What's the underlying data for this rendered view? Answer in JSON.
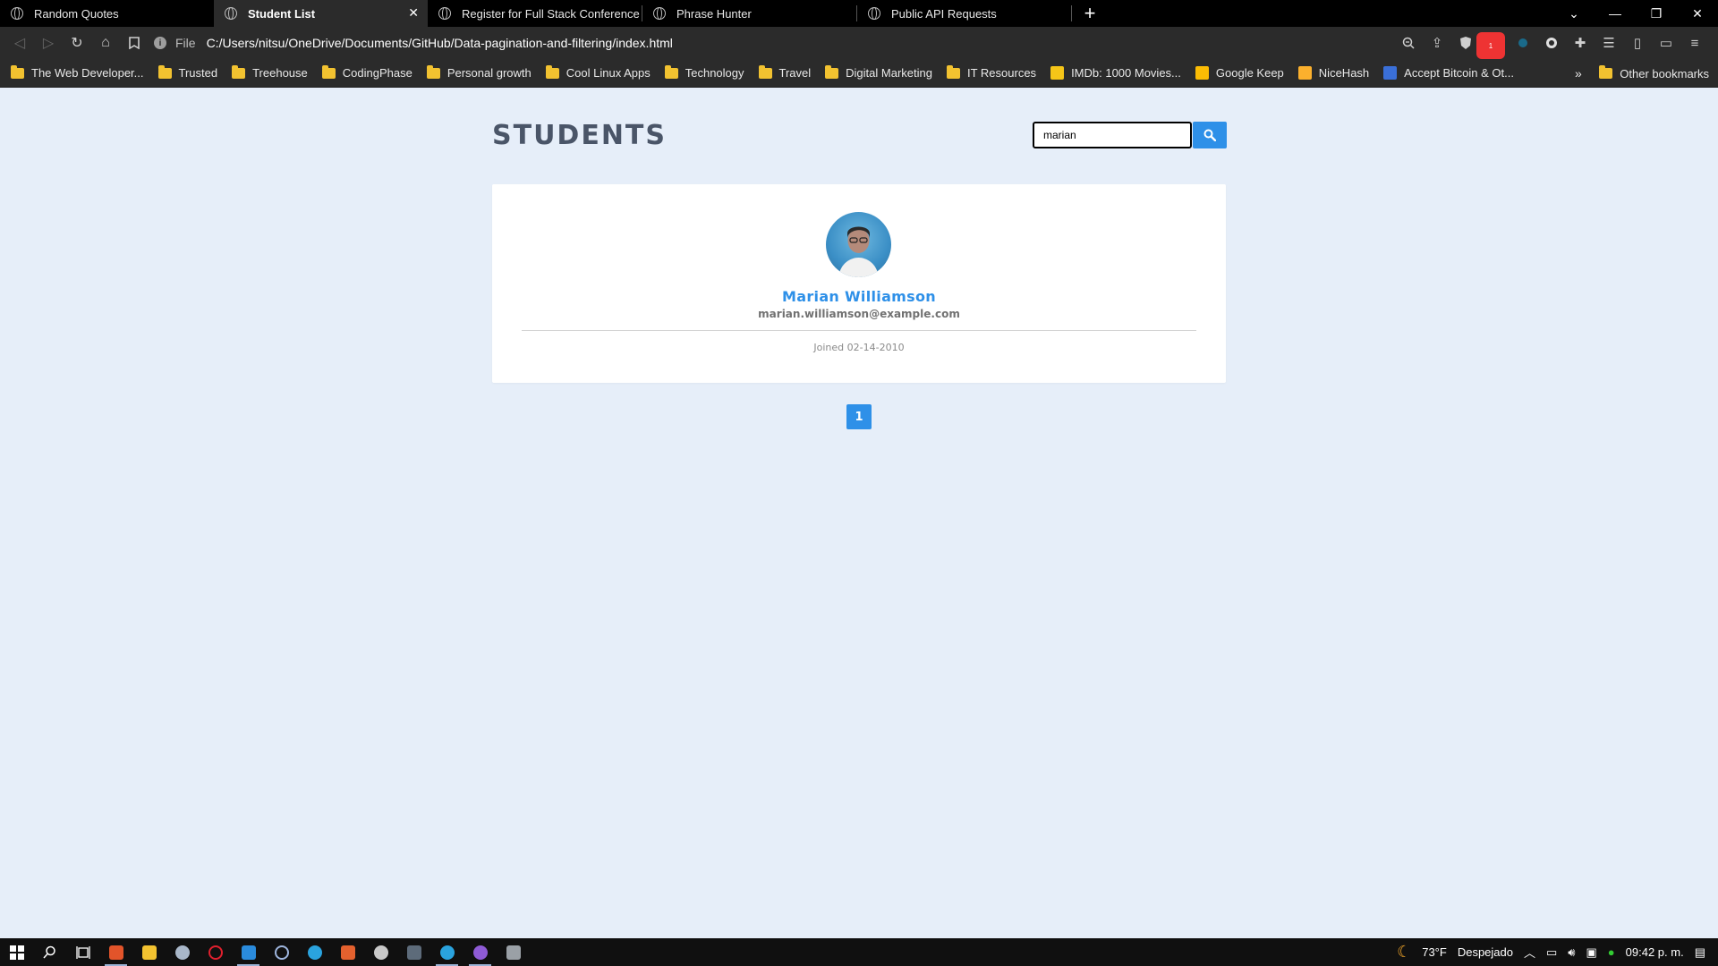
{
  "browser": {
    "tabs": [
      {
        "title": "Random Quotes",
        "active": false
      },
      {
        "title": "Student List",
        "active": true
      },
      {
        "title": "Register for Full Stack Conference",
        "active": false
      },
      {
        "title": "Phrase Hunter",
        "active": false
      },
      {
        "title": "Public API Requests",
        "active": false
      }
    ],
    "address": {
      "scheme": "File",
      "url": "C:/Users/nitsu/OneDrive/Documents/GitHub/Data-pagination-and-filtering/index.html"
    },
    "alert_badge_count": "1",
    "bookmarks": [
      {
        "label": "The Web Developer...",
        "icon": "folder-icon"
      },
      {
        "label": "Trusted",
        "icon": "folder-icon"
      },
      {
        "label": "Treehouse",
        "icon": "folder-icon"
      },
      {
        "label": "CodingPhase",
        "icon": "folder-icon"
      },
      {
        "label": "Personal growth",
        "icon": "folder-icon"
      },
      {
        "label": "Cool Linux Apps",
        "icon": "folder-icon"
      },
      {
        "label": "Technology",
        "icon": "folder-icon"
      },
      {
        "label": "Travel",
        "icon": "folder-icon"
      },
      {
        "label": "Digital Marketing",
        "icon": "folder-icon"
      },
      {
        "label": "IT Resources",
        "icon": "folder-icon"
      },
      {
        "label": "IMDb: 1000 Movies...",
        "icon": "imdb-icon"
      },
      {
        "label": "Google Keep",
        "icon": "keep-icon"
      },
      {
        "label": "NiceHash",
        "icon": "nicehash-icon"
      },
      {
        "label": "Accept Bitcoin & Ot...",
        "icon": "bitcoin-icon"
      }
    ],
    "other_bookmarks": "Other bookmarks"
  },
  "page": {
    "title": "STUDENTS",
    "search": {
      "value": "marian"
    },
    "student": {
      "name": "Marian Williamson",
      "email": "marian.williamson@example.com",
      "joined": "Joined 02-14-2010"
    },
    "pagination": [
      "1"
    ]
  },
  "taskbar": {
    "weather": "73°F",
    "weather_text": "Despejado",
    "time": "09:42 p. m."
  },
  "colors": {
    "accent": "#2e90e8",
    "page_bg": "#e6eef9",
    "title": "#4a5568"
  }
}
